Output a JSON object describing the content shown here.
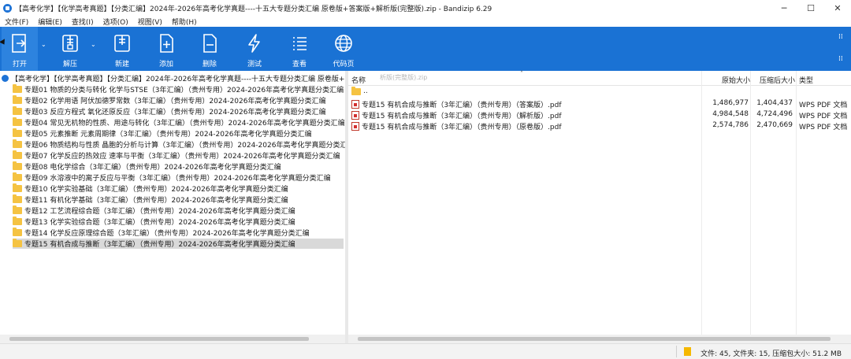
{
  "window": {
    "title": "【高考化学】【化学高考真题】【分类汇编】2024年-2026年高考化学真题----十五大专题分类汇编  原卷版+答案版+解析版(完整版).zip - Bandizip 6.29",
    "minimize": "─",
    "maximize": "☐",
    "close": "✕"
  },
  "menu": [
    "文件(F)",
    "编辑(E)",
    "查找(I)",
    "选项(O)",
    "视图(V)",
    "帮助(H)"
  ],
  "toolbar": {
    "open": "打开",
    "extract": "解压",
    "new": "新建",
    "add": "添加",
    "delete": "删除",
    "test": "测试",
    "view": "查看",
    "codepage": "代码页",
    "dropdown": "⌄",
    "grid": "⁞⁞"
  },
  "tree": {
    "root": "【高考化学】【化学高考真题】【分类汇编】2024年-2026年高考化学真题----十五大专题分类汇编  原卷版+答案",
    "items": [
      "专题01 物质的分类与转化 化学与STSE（3年汇编）（贵州专用）2024-2026年高考化学真题分类汇编",
      "专题02 化学用语 阿伏加德罗常数（3年汇编）（贵州专用）2024-2026年高考化学真题分类汇编",
      "专题03 反应方程式 氧化还原反应（3年汇编）（贵州专用）2024-2026年高考化学真题分类汇编",
      "专题04 常见无机物的性质、用途与转化（3年汇编）（贵州专用）2024-2026年高考化学真题分类汇编",
      "专题05 元素推断 元素周期律（3年汇编）（贵州专用）2024-2026年高考化学真题分类汇编",
      "专题06 物质结构与性质 晶胞的分析与计算（3年汇编）（贵州专用）2024-2026年高考化学真题分类汇编",
      "专题07 化学反应的热效应 速率与平衡（3年汇编）（贵州专用）2024-2026年高考化学真题分类汇编",
      "专题08 电化学综合（3年汇编）（贵州专用）2024-2026年高考化学真题分类汇编",
      "专题09 水溶液中的离子反应与平衡（3年汇编）（贵州专用）2024-2026年高考化学真题分类汇编",
      "专题10 化学实验基础（3年汇编）（贵州专用）2024-2026年高考化学真题分类汇编",
      "专题11 有机化学基础（3年汇编）（贵州专用）2024-2026年高考化学真题分类汇编",
      "专题12 工艺流程综合题（3年汇编）（贵州专用）2024-2026年高考化学真题分类汇编",
      "专题13 化学实验综合题（3年汇编）（贵州专用）2024-2026年高考化学真题分类汇编",
      "专题14 化学反应原理综合题（3年汇编）（贵州专用）2024-2026年高考化学真题分类汇编",
      "专题15 有机合成与推断（3年汇编）（贵州专用）2024-2026年高考化学真题分类汇编"
    ]
  },
  "files": {
    "tooltip": "析版(完整版).zip",
    "sort_arrow": "˄",
    "headers": {
      "name": "名称",
      "size": "原始大小",
      "packed": "压缩后大小",
      "type": "类型"
    },
    "parent": "..",
    "rows": [
      {
        "name": "专题15 有机合成与推断（3年汇编）（贵州专用）（答案版）.pdf",
        "size": "1,486,977",
        "packed": "1,404,437",
        "type": "WPS PDF 文档"
      },
      {
        "name": "专题15 有机合成与推断（3年汇编）（贵州专用）（解析版）.pdf",
        "size": "4,984,548",
        "packed": "4,724,496",
        "type": "WPS PDF 文档"
      },
      {
        "name": "专题15 有机合成与推断（3年汇编）（贵州专用）（原卷版）.pdf",
        "size": "2,574,786",
        "packed": "2,470,669",
        "type": "WPS PDF 文档"
      }
    ]
  },
  "status": {
    "text": "文件: 45, 文件夹: 15, 压缩包大小: 51.2 MB"
  }
}
